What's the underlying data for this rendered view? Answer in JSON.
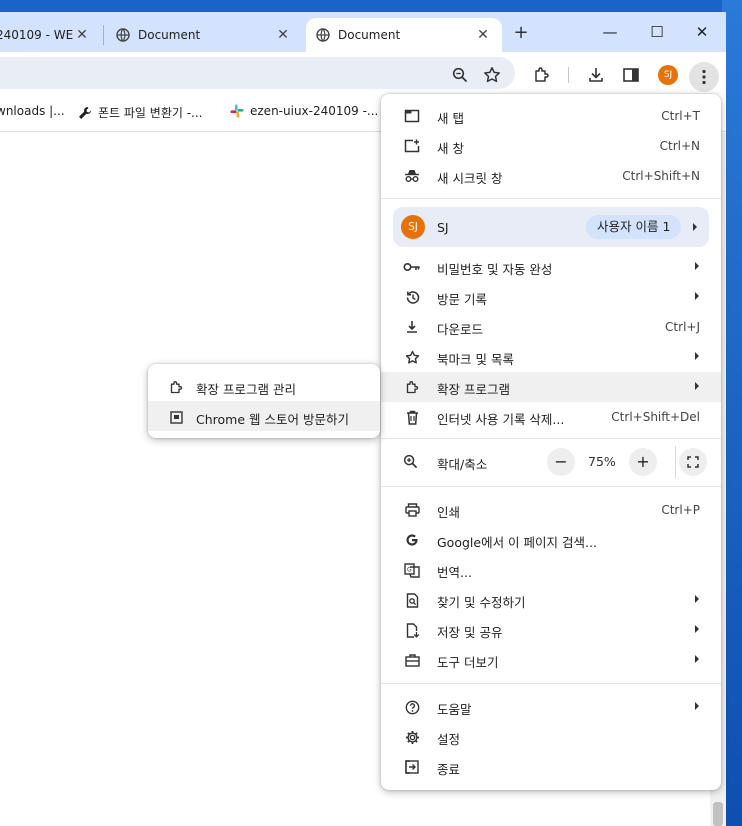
{
  "tabs": [
    {
      "title": "240109 - WE",
      "active": false
    },
    {
      "title": "Document",
      "active": false
    },
    {
      "title": "Document",
      "active": true
    }
  ],
  "newtab_symbol": "+",
  "window_controls": {
    "minimize": "—",
    "maximize": "☐",
    "close": "✕"
  },
  "toolbar": {
    "icons": [
      "zoom-icon",
      "bookmark-star-icon",
      "extensions-icon",
      "download-icon",
      "side-panel-icon",
      "kebab-menu-icon"
    ],
    "avatar_initials": "SJ"
  },
  "bookmarks": [
    {
      "label": "wnloads |...",
      "icon": "none"
    },
    {
      "label": "폰트 파일 변환기 -...",
      "icon": "wrench-icon"
    },
    {
      "label": "ezen-uiux-240109 -...",
      "icon": "slack-icon"
    }
  ],
  "menu": {
    "new_tab": {
      "label": "새 탭",
      "shortcut": "Ctrl+T"
    },
    "new_window": {
      "label": "새 창",
      "shortcut": "Ctrl+N"
    },
    "incognito": {
      "label": "새 시크릿 창",
      "shortcut": "Ctrl+Shift+N"
    },
    "profile": {
      "initials": "SJ",
      "name": "SJ",
      "chip": "사용자 이름 1"
    },
    "passwords": {
      "label": "비밀번호 및 자동 완성"
    },
    "history": {
      "label": "방문 기록"
    },
    "downloads": {
      "label": "다운로드",
      "shortcut": "Ctrl+J"
    },
    "bookmarks": {
      "label": "북마크 및 목록"
    },
    "extensions": {
      "label": "확장 프로그램"
    },
    "clear_data": {
      "label": "인터넷 사용 기록 삭제...",
      "shortcut": "Ctrl+Shift+Del"
    },
    "zoom": {
      "label": "확대/축소",
      "minus": "−",
      "value": "75%",
      "plus": "+"
    },
    "print": {
      "label": "인쇄",
      "shortcut": "Ctrl+P"
    },
    "google_search": {
      "label": "Google에서 이 페이지 검색..."
    },
    "translate": {
      "label": "번역..."
    },
    "find_edit": {
      "label": "찾기 및 수정하기"
    },
    "save_share": {
      "label": "저장 및 공유"
    },
    "more_tools": {
      "label": "도구 더보기"
    },
    "help": {
      "label": "도움말"
    },
    "settings": {
      "label": "설정"
    },
    "exit": {
      "label": "종료"
    }
  },
  "submenu": {
    "manage": {
      "label": "확장 프로그램 관리"
    },
    "webstore": {
      "label": "Chrome 웹 스토어 방문하기"
    }
  },
  "colors": {
    "tabstrip_bg": "#d3e3fd",
    "avatar_orange": "#e8710a",
    "profile_row_bg": "#e7ecf6",
    "profile_chip_bg": "#d3e3fd",
    "highlight_bg": "#f0f0f0"
  }
}
